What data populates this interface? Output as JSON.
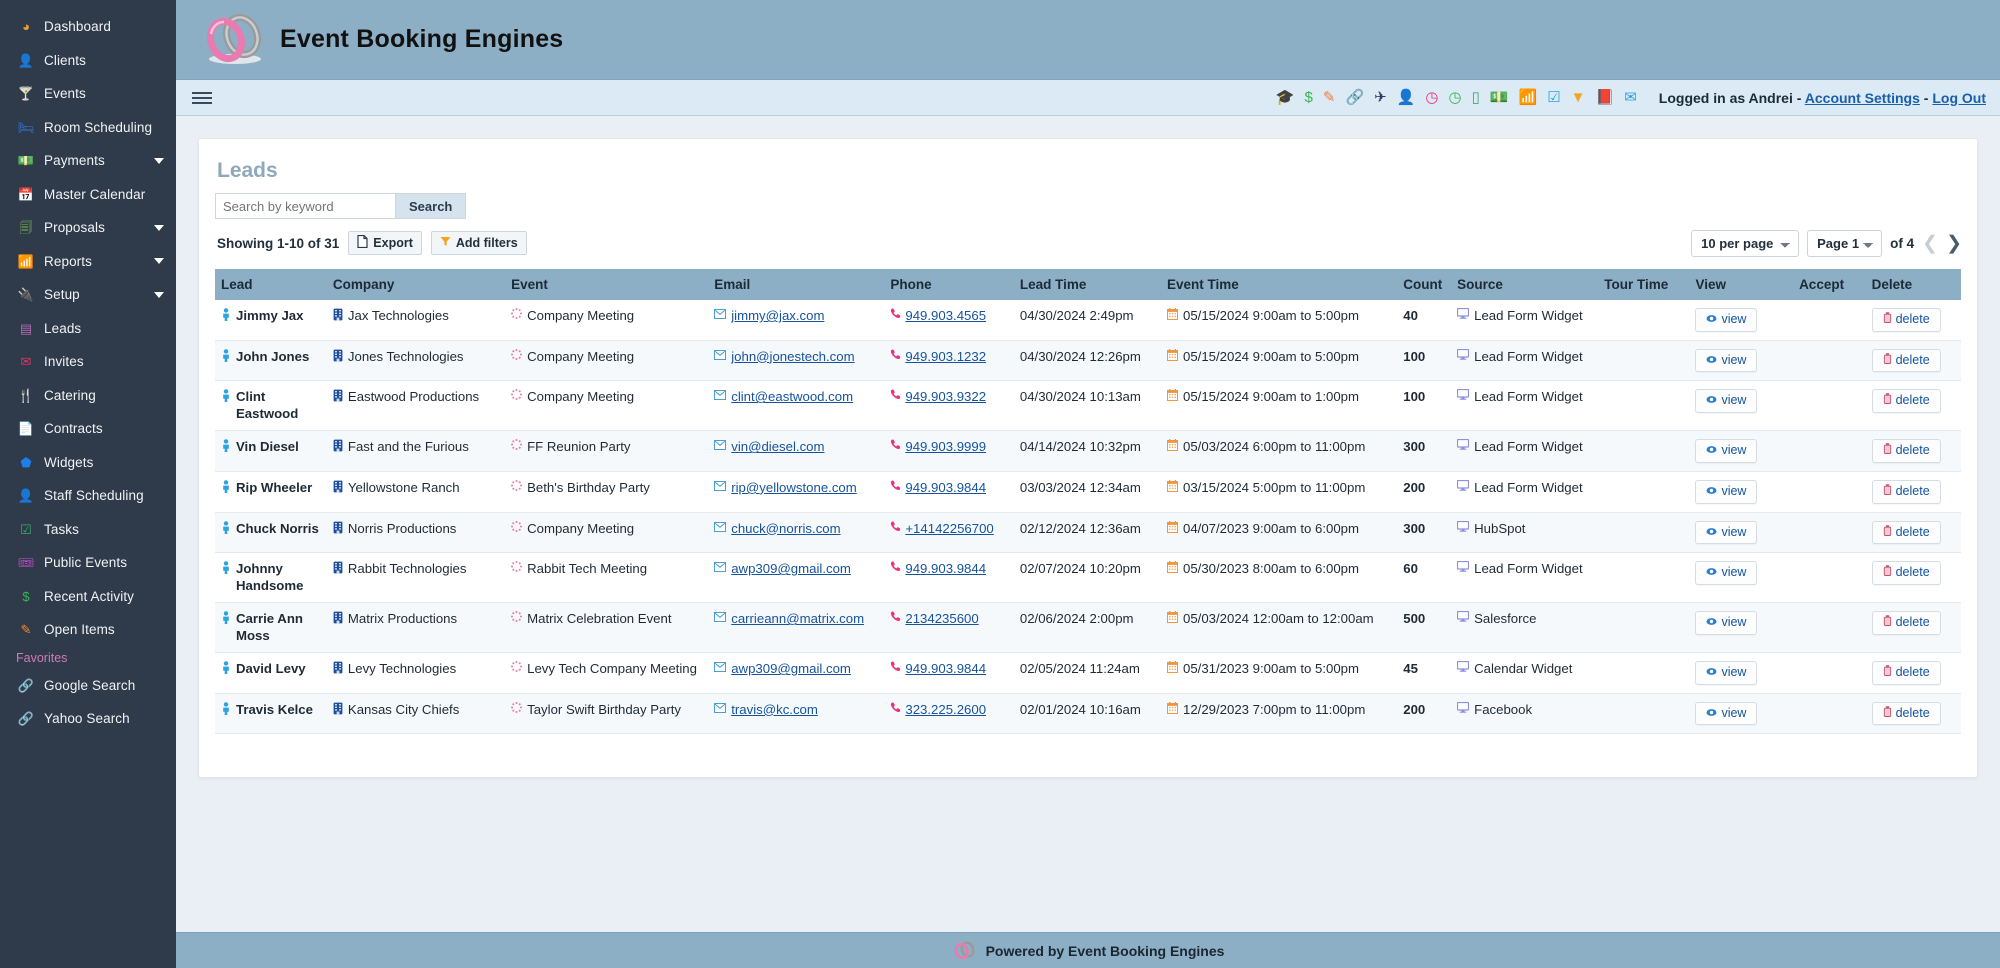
{
  "sidebar": {
    "items": [
      {
        "label": "Dashboard",
        "icon": "pie-chart-icon",
        "glyph": "◕",
        "color": "#f0a030",
        "caret": false
      },
      {
        "label": "Clients",
        "icon": "person-icon",
        "glyph": "👤",
        "color": "#2aa3e0",
        "caret": false
      },
      {
        "label": "Events",
        "icon": "cocktail-icon",
        "glyph": "🍸",
        "color": "#ef2f7e",
        "caret": false
      },
      {
        "label": "Room Scheduling",
        "icon": "rooms-icon",
        "glyph": "🛏",
        "color": "#2f7de0",
        "caret": false
      },
      {
        "label": "Payments",
        "icon": "money-icon",
        "glyph": "💵",
        "color": "#46b96a",
        "caret": true
      },
      {
        "label": "Master Calendar",
        "icon": "calendar-icon",
        "glyph": "📅",
        "color": "#35b9a6",
        "caret": false
      },
      {
        "label": "Proposals",
        "icon": "copy-icon",
        "glyph": "🗐",
        "color": "#7fc14a",
        "caret": true
      },
      {
        "label": "Reports",
        "icon": "bar-chart-icon",
        "glyph": "📶",
        "color": "#f08a2c",
        "caret": true
      },
      {
        "label": "Setup",
        "icon": "plug-icon",
        "glyph": "🔌",
        "color": "#5fc27e",
        "caret": true
      },
      {
        "label": "Leads",
        "icon": "list-icon",
        "glyph": "▤",
        "color": "#b569b5",
        "caret": false
      },
      {
        "label": "Invites",
        "icon": "envelope-icon",
        "glyph": "✉",
        "color": "#e0365e",
        "caret": false
      },
      {
        "label": "Catering",
        "icon": "utensils-icon",
        "glyph": "🍴",
        "color": "#2aa3e0",
        "caret": false
      },
      {
        "label": "Contracts",
        "icon": "document-icon",
        "glyph": "📄",
        "color": "#2fae8e",
        "caret": false
      },
      {
        "label": "Widgets",
        "icon": "widget-icon",
        "glyph": "⬟",
        "color": "#1f7fe8",
        "caret": false
      },
      {
        "label": "Staff Scheduling",
        "icon": "staff-icon",
        "glyph": "👤",
        "color": "#9f92de",
        "caret": false
      },
      {
        "label": "Tasks",
        "icon": "checkbox-icon",
        "glyph": "☑",
        "color": "#3bab6b",
        "caret": false
      },
      {
        "label": "Public Events",
        "icon": "ticket-icon",
        "glyph": "🎟",
        "color": "#d54fd5",
        "caret": false
      },
      {
        "label": "Recent Activity",
        "icon": "dollar-icon",
        "glyph": "$",
        "color": "#35b94e",
        "caret": false
      },
      {
        "label": "Open Items",
        "icon": "edit-icon",
        "glyph": "✎",
        "color": "#f08a2c",
        "caret": false
      }
    ],
    "favorites_header": "Favorites",
    "favorites": [
      {
        "label": "Google Search",
        "icon": "link-icon",
        "glyph": "🔗",
        "color": "#f08a2c"
      },
      {
        "label": "Yahoo Search",
        "icon": "link-icon",
        "glyph": "🔗",
        "color": "#2aa3e0"
      }
    ]
  },
  "brand": {
    "title": "Event Booking Engines",
    "logo_icon": "wedding-rings-logo"
  },
  "toolbar": {
    "menu_icon": "hamburger-menu-icon",
    "icons": [
      {
        "name": "graduation-cap-icon",
        "glyph": "🎓",
        "color": "#2f6f9f"
      },
      {
        "name": "dollar-icon",
        "glyph": "$",
        "color": "#35b94e"
      },
      {
        "name": "edit-note-icon",
        "glyph": "✎",
        "color": "#f4793b"
      },
      {
        "name": "link-icon",
        "glyph": "🔗",
        "color": "#ef2f7e"
      },
      {
        "name": "airplane-icon",
        "glyph": "✈",
        "color": "#2f3a6b"
      },
      {
        "name": "person-icon",
        "glyph": "👤",
        "color": "#2aa3e0"
      },
      {
        "name": "clock-pink-icon",
        "glyph": "◷",
        "color": "#ef2f7e"
      },
      {
        "name": "clock-green-icon",
        "glyph": "◷",
        "color": "#35b94e"
      },
      {
        "name": "mobile-icon",
        "glyph": "▯",
        "color": "#3bab6b"
      },
      {
        "name": "cash-icon",
        "glyph": "💵",
        "color": "#3bab6b"
      },
      {
        "name": "bar-chart-icon",
        "glyph": "📶",
        "color": "#f08a2c"
      },
      {
        "name": "checkbox-icon",
        "glyph": "☑",
        "color": "#2aa3e0"
      },
      {
        "name": "filter-icon",
        "glyph": "▼",
        "color": "#f4a423"
      },
      {
        "name": "book-icon",
        "glyph": "📕",
        "color": "#3bab6b"
      },
      {
        "name": "envelope-icon",
        "glyph": "✉",
        "color": "#2aa3e0"
      }
    ],
    "logged_in_text": "Logged in as Andrei - ",
    "account_settings": "Account Settings",
    "separator": " - ",
    "log_out": "Log Out"
  },
  "page": {
    "title": "Leads",
    "search_placeholder": "Search by keyword",
    "search_value": "",
    "search_button": "Search",
    "showing": "Showing 1-10 of 31",
    "export_button": "Export",
    "add_filters_button": "Add filters",
    "per_page": "10 per page",
    "page_select": "Page 1",
    "of_pages": "of 4",
    "prev_arrow": "❮",
    "next_arrow": "❯"
  },
  "table": {
    "columns": [
      "Lead",
      "Company",
      "Event",
      "Email",
      "Phone",
      "Lead Time",
      "Event Time",
      "Count",
      "Source",
      "Tour Time",
      "View",
      "Accept",
      "Delete"
    ],
    "view_label": "view",
    "delete_label": "delete",
    "rows": [
      {
        "lead": "Jimmy Jax",
        "company": "Jax Technologies",
        "event": "Company Meeting",
        "email": "jimmy@jax.com",
        "phone": "949.903.4565",
        "lead_time": "04/30/2024 2:49pm",
        "event_time": "05/15/2024 9:00am to 5:00pm",
        "count": "40",
        "source": "Lead Form Widget",
        "tour_time": ""
      },
      {
        "lead": "John Jones",
        "company": "Jones Technologies",
        "event": "Company Meeting",
        "email": "john@jonestech.com",
        "phone": "949.903.1232",
        "lead_time": "04/30/2024 12:26pm",
        "event_time": "05/15/2024 9:00am to 5:00pm",
        "count": "100",
        "source": "Lead Form Widget",
        "tour_time": ""
      },
      {
        "lead": "Clint Eastwood",
        "company": "Eastwood Productions",
        "event": "Company Meeting",
        "email": "clint@eastwood.com",
        "phone": "949.903.9322",
        "lead_time": "04/30/2024 10:13am",
        "event_time": "05/15/2024 9:00am to 1:00pm",
        "count": "100",
        "source": "Lead Form Widget",
        "tour_time": ""
      },
      {
        "lead": "Vin Diesel",
        "company": "Fast and the Furious",
        "event": "FF Reunion Party",
        "email": "vin@diesel.com",
        "phone": "949.903.9999",
        "lead_time": "04/14/2024 10:32pm",
        "event_time": "05/03/2024 6:00pm to 11:00pm",
        "count": "300",
        "source": "Lead Form Widget",
        "tour_time": ""
      },
      {
        "lead": "Rip Wheeler",
        "company": "Yellowstone Ranch",
        "event": "Beth's Birthday Party",
        "email": "rip@yellowstone.com",
        "phone": "949.903.9844",
        "lead_time": "03/03/2024 12:34am",
        "event_time": "03/15/2024 5:00pm to 11:00pm",
        "count": "200",
        "source": "Lead Form Widget",
        "tour_time": ""
      },
      {
        "lead": "Chuck Norris",
        "company": "Norris Productions",
        "event": "Company Meeting",
        "email": "chuck@norris.com",
        "phone": "+14142256700",
        "lead_time": "02/12/2024 12:36am",
        "event_time": "04/07/2023 9:00am to 6:00pm",
        "count": "300",
        "source": "HubSpot",
        "tour_time": ""
      },
      {
        "lead": "Johnny Handsome",
        "company": "Rabbit Technologies",
        "event": "Rabbit Tech Meeting",
        "email": "awp309@gmail.com",
        "phone": "949.903.9844",
        "lead_time": "02/07/2024 10:20pm",
        "event_time": "05/30/2023 8:00am to 6:00pm",
        "count": "60",
        "source": "Lead Form Widget",
        "tour_time": ""
      },
      {
        "lead": "Carrie Ann Moss",
        "company": "Matrix Productions",
        "event": "Matrix Celebration Event",
        "email": "carrieann@matrix.com",
        "phone": "2134235600",
        "lead_time": "02/06/2024 2:00pm",
        "event_time": "05/03/2024 12:00am to 12:00am",
        "count": "500",
        "source": "Salesforce",
        "tour_time": ""
      },
      {
        "lead": "David Levy",
        "company": "Levy Technologies",
        "event": "Levy Tech Company Meeting",
        "email": "awp309@gmail.com",
        "phone": "949.903.9844",
        "lead_time": "02/05/2024 11:24am",
        "event_time": "05/31/2023 9:00am to 5:00pm",
        "count": "45",
        "source": "Calendar Widget",
        "tour_time": ""
      },
      {
        "lead": "Travis Kelce",
        "company": "Kansas City Chiefs",
        "event": "Taylor Swift Birthday Party",
        "email": "travis@kc.com",
        "phone": "323.225.2600",
        "lead_time": "02/01/2024 10:16am",
        "event_time": "12/29/2023 7:00pm to 11:00pm",
        "count": "200",
        "source": "Facebook",
        "tour_time": ""
      }
    ]
  },
  "footer": {
    "text": "Powered by Event Booking Engines",
    "logo_icon": "wedding-rings-logo"
  },
  "colors": {
    "sidebar_bg": "#2f3a4a",
    "brand_bg": "#8cafc6",
    "toolbar_bg": "#dbeaf4",
    "link": "#15539e",
    "count_green": "#18803f",
    "title_blue": "#8fa9bb"
  }
}
